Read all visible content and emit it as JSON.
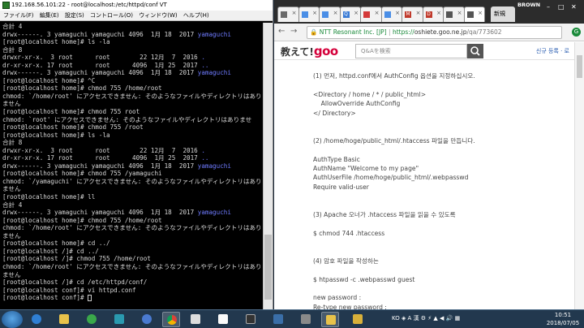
{
  "terminal": {
    "title": "192.168.56.101:22 - root@localhost:/etc/httpd/conf VT",
    "menu": [
      "ファイル(F)",
      "編集(E)",
      "設定(S)",
      "コントロール(O)",
      "ウィンドウ(W)",
      "ヘルプ(H)"
    ],
    "lines": [
      {
        "text": "合計 4"
      },
      {
        "text": "drwx------. 3 yamaguchi yamaguchi 4096  1月 18  2017 ",
        "dir": "yamaguchi"
      },
      {
        "text": "[root@localhost home]# ls -la"
      },
      {
        "text": "合計 8"
      },
      {
        "text": "drwxr-xr-x.  3 root      root        22 12月  7  2016 ",
        "dir": "."
      },
      {
        "text": "dr-xr-xr-x. 17 root      root      4096  1月 25  2017 ",
        "dir": ".."
      },
      {
        "text": "drwx------. 3 yamaguchi yamaguchi 4096  1月 18  2017 ",
        "dir": "yamaguchi"
      },
      {
        "text": "[root@localhost home]# ^C"
      },
      {
        "text": "[root@localhost home]# chmod 755 /home/root"
      },
      {
        "text": "chmod: `/home/root' にアクセスできません: そのようなファイルやディレクトリはあり"
      },
      {
        "text": "ません"
      },
      {
        "text": "[root@localhost home]# chmod 755 root"
      },
      {
        "text": "chmod: `root' にアクセスできません: そのようなファイルやディレクトリはありませ"
      },
      {
        "text": "[root@localhost home]# chmod 755 /root"
      },
      {
        "text": "[root@localhost home]# ls -la"
      },
      {
        "text": "合計 8"
      },
      {
        "text": "drwxr-xr-x.  3 root      root        22 12月  7  2016 ",
        "dir": "."
      },
      {
        "text": "dr-xr-xr-x. 17 root      root      4096  1月 25  2017 ",
        "dir": ".."
      },
      {
        "text": "drwx------. 3 yamaguchi yamaguchi 4096  1月 18  2017 ",
        "dir": "yamaguchi"
      },
      {
        "text": "[root@localhost home]# chmod 755 /yamaguchi"
      },
      {
        "text": "chmod: `/yamaguchi' にアクセスできません: そのようなファイルやディレクトリはあり"
      },
      {
        "text": "ません"
      },
      {
        "text": "[root@localhost home]# ll"
      },
      {
        "text": "合計 4"
      },
      {
        "text": "drwx------. 3 yamaguchi yamaguchi 4096  1月 18  2017 ",
        "dir": "yamaguchi"
      },
      {
        "text": "[root@localhost home]# chmod 755 /home/root"
      },
      {
        "text": "chmod: `/home/root' にアクセスできません: そのようなファイルやディレクトリはあり"
      },
      {
        "text": "ません"
      },
      {
        "text": "[root@localhost home]# cd ../"
      },
      {
        "text": "[root@localhost /]# cd ../"
      },
      {
        "text": "[root@localhost /]# chmod 755 /home/root"
      },
      {
        "text": "chmod: `/home/root' にアクセスできません: そのようなファイルやディレクトリはあり"
      },
      {
        "text": "ません"
      },
      {
        "text": "[root@localhost /]# cd /etc/httpd/conf/"
      },
      {
        "text": "[root@localhost conf]# vi httpd.conf"
      },
      {
        "text": "[root@localhost conf]# ",
        "cursor": true
      }
    ],
    "dir_color": "#6f7bff"
  },
  "browser": {
    "tab_icon_colors": [
      "#6b6b6b",
      "#4a8ee6",
      "#4a8ee6",
      "#3a7bd5",
      "#d43a3a",
      "#4a8ee6",
      "#c0392b",
      "#c0392b",
      "#555555",
      "#555555"
    ],
    "tab_letters": [
      "",
      "",
      "",
      "Q",
      "",
      "",
      "M",
      "D",
      "",
      ""
    ],
    "new_tab_label": "新規",
    "profile_label": "BROWN",
    "address": {
      "org": "NTT Resonant Inc. [JP]",
      "scheme": "https://",
      "host": "oshiete.goo.ne.jp",
      "path": "/qa/773602"
    }
  },
  "site": {
    "logo_text": "教えて!",
    "logo_brand": "goo",
    "search_placeholder": "Q&Aを検索",
    "signup_label": "신규 등록 · 로",
    "brand_color": "#d4003a"
  },
  "answer": {
    "lines": [
      "(1) 먼저, httpd.conf에서 AuthConfig 옵션을 지정하십시오.",
      "",
      "<Directory / home / * / public_html>",
      "    AllowOverride AuthConfig",
      "</ Directory>",
      "",
      "",
      "(2) /home/hoge/public_html/.htaccess 파일을 만듭니다.",
      "",
      "AuthType Basic",
      "AuthName \"Welcome to my page\"",
      "AuthUserFile /home/hoge/public_html/.webpasswd",
      "Require valid-user",
      "",
      "",
      "(3) Apache 오너가 .htaccess 파일을 읽을 수 있도록",
      "",
      "$ chmod 744 .htaccess",
      "",
      "",
      "(4) 암호 파일을 작성하는",
      "",
      "$ htpasswd -c .webpasswd guest",
      "",
      "new password :",
      "Re-type new password :"
    ]
  },
  "taskbar": {
    "tray_text": "KO  ◈ A 漢 ⚙ ⚡ ▲ ◀ 🔊 ▦",
    "time": "10:51",
    "date": "2018/07/05"
  }
}
